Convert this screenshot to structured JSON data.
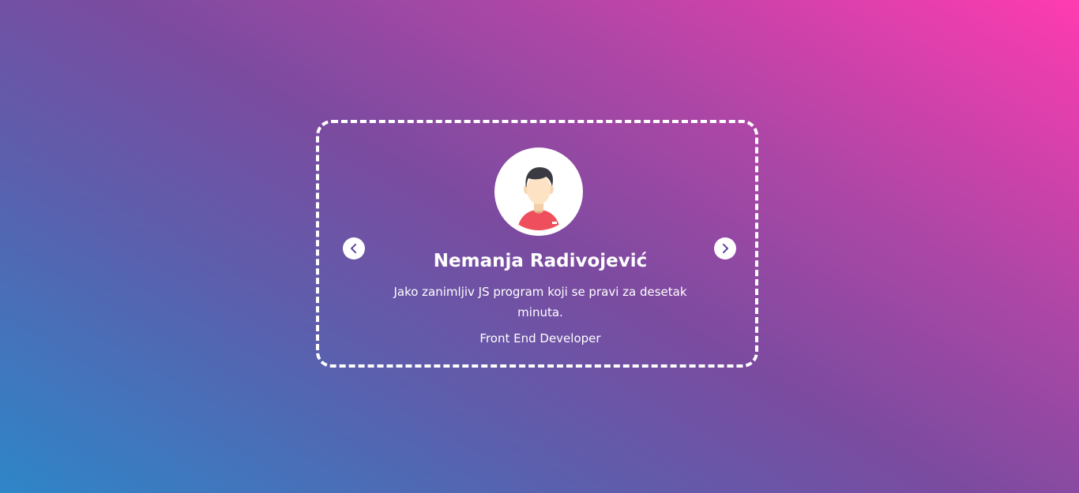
{
  "testimonial": {
    "name": "Nemanja Radivojević",
    "quote": "Jako zanimljiv JS program koji se pravi za desetak minuta.",
    "role": "Front End Developer",
    "avatar_icon": "user-avatar-icon"
  },
  "navigation": {
    "prev_icon": "chevron-left-icon",
    "next_icon": "chevron-right-icon"
  },
  "colors": {
    "gradient_start": "#2e86c8",
    "gradient_mid": "#7b4ba0",
    "gradient_end": "#ff3bb0",
    "card_border": "#ffffff",
    "text": "#ffffff",
    "nav_icon": "#5b4aa0"
  }
}
